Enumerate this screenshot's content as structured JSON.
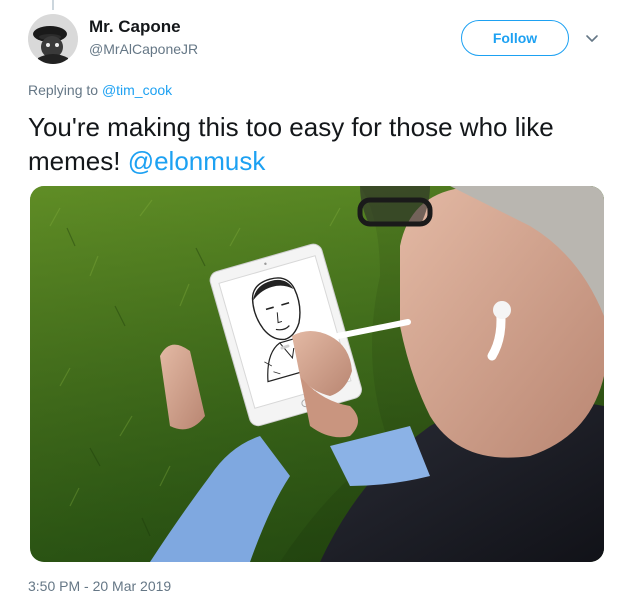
{
  "author": {
    "display_name": "Mr. Capone",
    "handle": "@MrAlCaponeJR"
  },
  "actions": {
    "follow_label": "Follow",
    "more_icon": "chevron-down-icon"
  },
  "reply": {
    "prefix": "Replying to",
    "target": "@tim_cook"
  },
  "tweet": {
    "text": "You're making this too easy for those who like memes!",
    "mention": "@elonmusk"
  },
  "media": {
    "description": "photo"
  },
  "meta": {
    "timestamp": "3:50 PM - 20 Mar 2019"
  },
  "colors": {
    "accent": "#1da1f2",
    "muted": "#657786",
    "text": "#14171a"
  }
}
